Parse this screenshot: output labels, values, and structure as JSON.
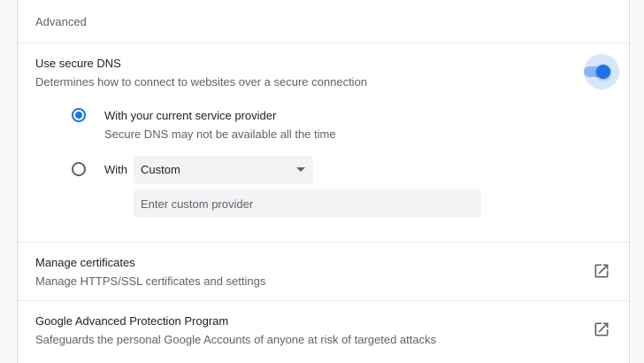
{
  "section": {
    "title": "Advanced"
  },
  "secure_dns": {
    "title": "Use secure DNS",
    "subtitle": "Determines how to connect to websites over a secure connection",
    "enabled": true,
    "options": [
      {
        "label": "With your current service provider",
        "sublabel": "Secure DNS may not be available all the time",
        "selected": true
      },
      {
        "label": "With",
        "selected": false
      }
    ],
    "provider_select": {
      "value": "Custom"
    },
    "custom_provider_input": {
      "value": "",
      "placeholder": "Enter custom provider"
    }
  },
  "manage_certificates": {
    "title": "Manage certificates",
    "subtitle": "Manage HTTPS/SSL certificates and settings",
    "icon": "open-in-new-icon"
  },
  "advanced_protection": {
    "title": "Google Advanced Protection Program",
    "subtitle": "Safeguards the personal Google Accounts of anyone at risk of targeted attacks",
    "icon": "open-in-new-icon"
  },
  "colors": {
    "accent": "#1a73e8",
    "accent_light": "#8ab4f8",
    "secondary_text": "#5f6368"
  }
}
